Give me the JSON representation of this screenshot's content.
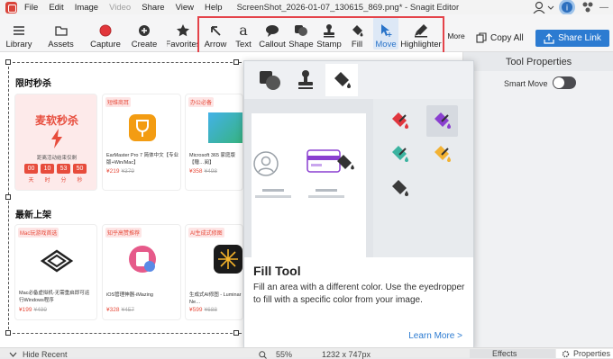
{
  "menubar": {
    "items": [
      {
        "label": "File",
        "disabled": false
      },
      {
        "label": "Edit",
        "disabled": false
      },
      {
        "label": "Image",
        "disabled": false
      },
      {
        "label": "Video",
        "disabled": true
      },
      {
        "label": "Share",
        "disabled": false
      },
      {
        "label": "View",
        "disabled": false
      },
      {
        "label": "Help",
        "disabled": false
      }
    ],
    "window_title": "ScreenShot_2026-01-07_130615_869.png* - Snagit Editor"
  },
  "toolbar": {
    "library": "Library",
    "assets": "Assets",
    "capture": "Capture",
    "create": "Create",
    "favorites": "Favorites",
    "tools": [
      "Arrow",
      "Text",
      "Callout",
      "Shape",
      "Stamp",
      "Fill",
      "Move",
      "Highlighter"
    ],
    "active_tool": "Move",
    "more": "More",
    "copy_all": "Copy All",
    "share_link": "Share Link"
  },
  "canvas": {
    "section1_title": "限时秒杀",
    "flash": {
      "title": "麦软秒杀",
      "subtitle": "距离活动结束仅剩",
      "countdown": [
        "00",
        "10",
        "53",
        "50"
      ],
      "units": [
        "天",
        "时",
        "分",
        "秒"
      ]
    },
    "cards_row1": [
      {
        "tag": "短维商耳",
        "name": "EarMaster Pro 7 简体中文【专业版+Win/Mac】",
        "price": "¥219",
        "old": "¥379"
      },
      {
        "tag": "办公必备",
        "name": "Microsoft 365 家庭版【赠…阅】",
        "price": "¥358",
        "old": "¥498"
      }
    ],
    "section2_title": "最新上架",
    "cards_row2": [
      {
        "tag": "Mac玩游戏首选",
        "name": "Mac必备虚拟机-无需重启即可运行Windows程序",
        "price": "¥199",
        "old": "¥499"
      },
      {
        "tag": "知乎高赞推荐",
        "name": "iOS管理神器-iMazing",
        "price": "¥328",
        "old": "¥457"
      },
      {
        "tag": "AI生成式修图",
        "name": "生成式AI修图 - Luminar Ne…",
        "price": "¥599",
        "old": "¥688"
      }
    ]
  },
  "popup": {
    "title": "Fill Tool",
    "description": "Fill an area with a different color. Use the eyedropper to fill with a specific color from your image.",
    "link": "Learn More >"
  },
  "right_panel": {
    "title": "Tool Properties",
    "smart_move_label": "Smart Move",
    "smart_move_on": false
  },
  "statusbar": {
    "hide_recent": "Hide Recent",
    "zoom": "55%",
    "dimensions": "1232 x 747px",
    "effects": "Effects",
    "properties": "Properties"
  },
  "colors": {
    "accent": "#2c7bd1",
    "highlight_box": "#e4434a",
    "fill_red": "#e0363e",
    "fill_purple": "#8a3fd0",
    "fill_teal": "#3bb3a0",
    "fill_yellow": "#f2b233"
  }
}
